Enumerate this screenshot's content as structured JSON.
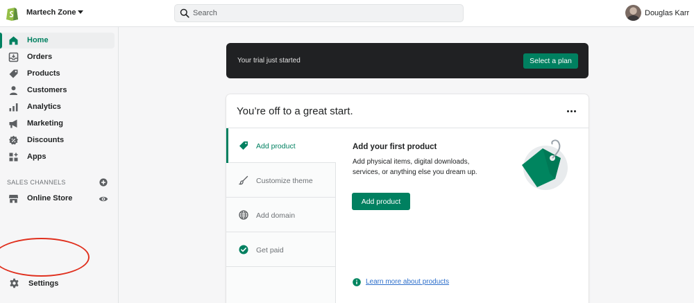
{
  "header": {
    "store_name": "Martech Zone",
    "search_placeholder": "Search",
    "user_name": "Douglas Karr"
  },
  "sidebar": {
    "items": [
      {
        "label": "Home",
        "icon": "home-icon"
      },
      {
        "label": "Orders",
        "icon": "orders-icon"
      },
      {
        "label": "Products",
        "icon": "tag-icon"
      },
      {
        "label": "Customers",
        "icon": "person-icon"
      },
      {
        "label": "Analytics",
        "icon": "bar-chart-icon"
      },
      {
        "label": "Marketing",
        "icon": "megaphone-icon"
      },
      {
        "label": "Discounts",
        "icon": "discount-icon"
      },
      {
        "label": "Apps",
        "icon": "apps-icon"
      }
    ],
    "sales_channels_label": "SALES CHANNELS",
    "online_store_label": "Online Store",
    "settings_label": "Settings"
  },
  "banner": {
    "text": "Your trial just started",
    "button": "Select a plan"
  },
  "card": {
    "title": "You’re off to a great start.",
    "tasks": [
      {
        "label": "Add product",
        "icon": "tag-icon"
      },
      {
        "label": "Customize theme",
        "icon": "brush-icon"
      },
      {
        "label": "Add domain",
        "icon": "globe-icon"
      },
      {
        "label": "Get paid",
        "icon": "check-circle-icon"
      }
    ],
    "detail_title": "Add your first product",
    "detail_desc": "Add physical items, digital downloads, services, or anything else you dream up.",
    "detail_button": "Add product",
    "learn_more": "Learn more about products"
  },
  "colors": {
    "accent": "#008060",
    "banner_bg": "#202123",
    "highlight": "#e0301e",
    "link": "#2c6ecb"
  }
}
